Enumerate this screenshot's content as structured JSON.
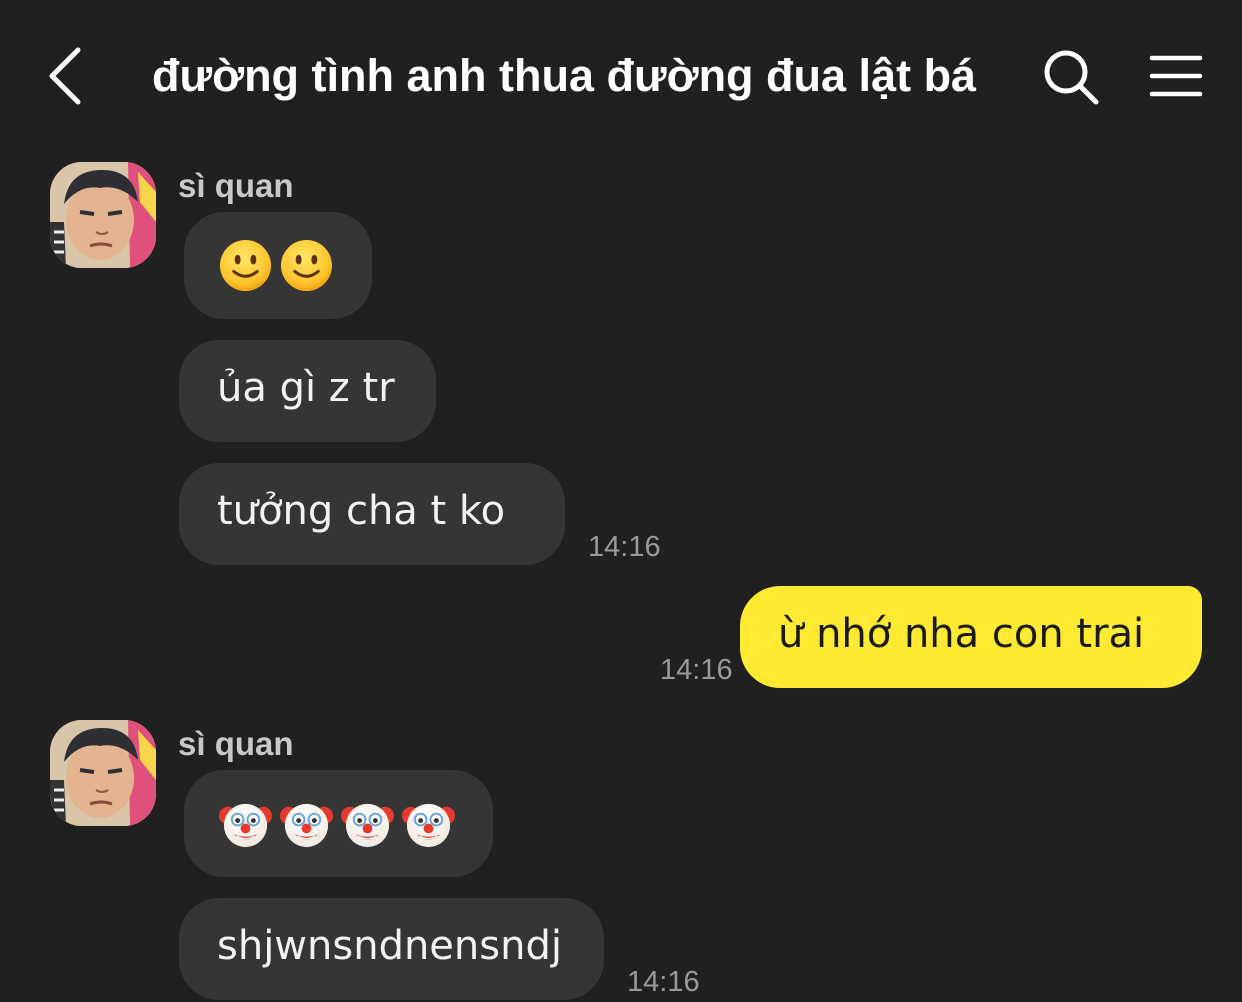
{
  "header": {
    "title": "đường tình anh thua đường đua lật bá",
    "back_icon": "chevron-left-icon",
    "search_icon": "search-icon",
    "menu_icon": "hamburger-menu-icon"
  },
  "colors": {
    "background": "#202020",
    "incoming_bubble": "#353535",
    "outgoing_bubble": "#fee933",
    "timestamp": "#9a9a9a"
  },
  "messages": [
    {
      "sender": "sì quan",
      "bubbles": [
        {
          "type": "emoji",
          "content": [
            "smiling-face-emoji",
            "smiling-face-emoji"
          ]
        },
        {
          "type": "text",
          "content": "ủa gì z tr"
        },
        {
          "type": "text",
          "content": "tưởng cha t ko"
        }
      ],
      "time": "14:16"
    },
    {
      "sender": "me",
      "bubbles": [
        {
          "type": "text",
          "content": "ừ nhớ nha con trai"
        }
      ],
      "time": "14:16"
    },
    {
      "sender": "sì quan",
      "bubbles": [
        {
          "type": "emoji",
          "content": [
            "clown-face-emoji",
            "clown-face-emoji",
            "clown-face-emoji",
            "clown-face-emoji"
          ]
        },
        {
          "type": "text",
          "content": "shjwnsndnensndj"
        }
      ],
      "time": "14:16"
    }
  ]
}
